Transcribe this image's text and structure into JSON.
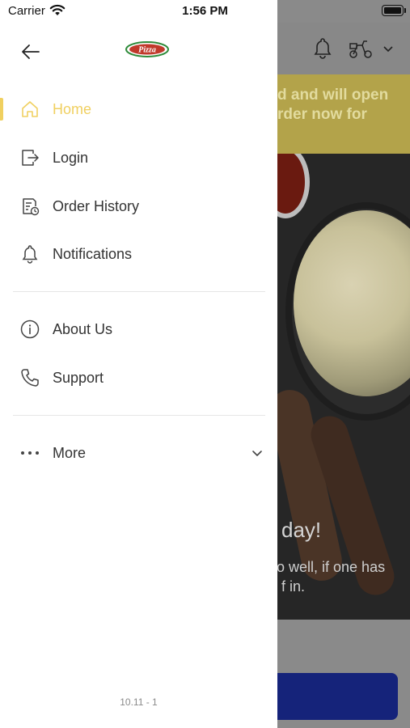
{
  "status_bar": {
    "carrier": "Carrier",
    "time": "1:56 PM",
    "battery_level": 1.0
  },
  "drawer": {
    "header": {
      "back_icon": "arrow-left-icon",
      "logo_text": "Pizza"
    },
    "menu": [
      {
        "label": "Home",
        "icon": "home-icon",
        "active": true
      },
      {
        "label": "Login",
        "icon": "login-icon",
        "active": false
      },
      {
        "label": "Order History",
        "icon": "order-history-icon",
        "active": false
      },
      {
        "label": "Notifications",
        "icon": "bell-icon",
        "active": false
      }
    ],
    "secondary_menu": [
      {
        "label": "About Us",
        "icon": "info-icon"
      },
      {
        "label": "Support",
        "icon": "phone-icon"
      }
    ],
    "more": {
      "label": "More",
      "icon": "more-dots-icon"
    },
    "version": "10.11 - 1"
  },
  "background": {
    "banner_lines": [
      "d and will open",
      "rder now for"
    ],
    "hero_title": "day!",
    "hero_sub_lines": [
      "o well, if one has",
      "f in."
    ]
  },
  "colors": {
    "accent": "#f0d060",
    "text": "#333333",
    "muted": "#8a8a8a",
    "cta": "#15237a",
    "logo_red": "#c0392b",
    "logo_green": "#2e8b3a"
  }
}
